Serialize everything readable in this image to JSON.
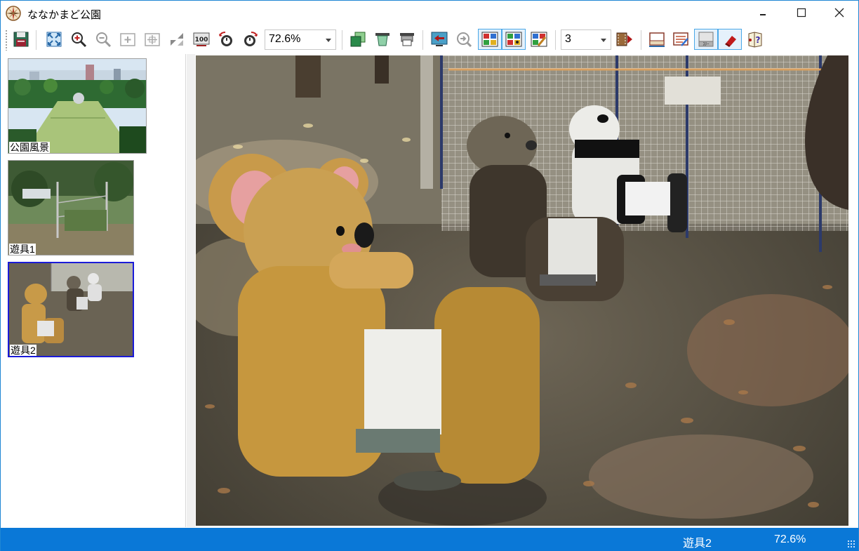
{
  "window": {
    "title": "ななかまど公園",
    "icon": "compass-icon"
  },
  "toolbar": {
    "zoom_value": "72.6%",
    "page_value": "3"
  },
  "thumbnails": [
    {
      "label": "公園風景",
      "selected": false
    },
    {
      "label": "遊具1",
      "selected": false
    },
    {
      "label": "遊具2",
      "selected": true
    }
  ],
  "statusbar": {
    "image_name": "遊具2",
    "zoom": "72.6%"
  },
  "colors": {
    "accent": "#0a78d7",
    "selection": "#1a1ad8"
  }
}
